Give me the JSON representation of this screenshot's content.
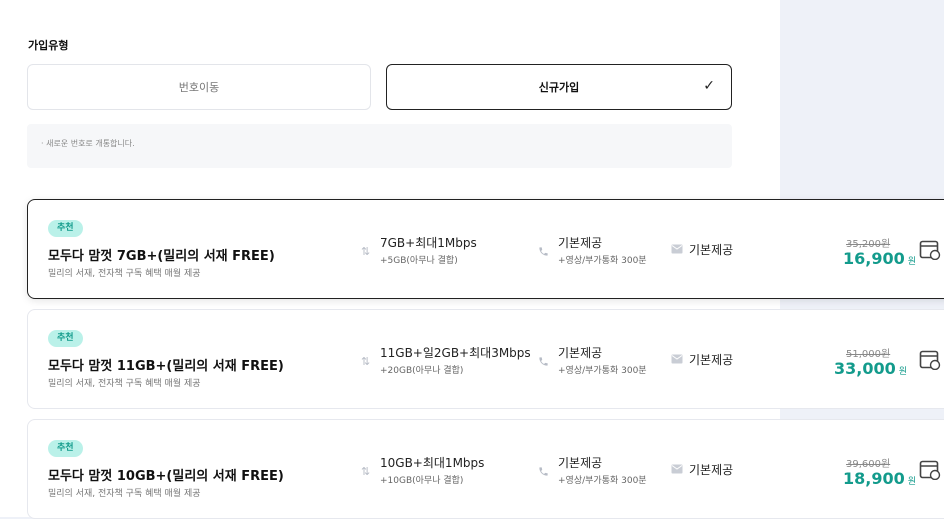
{
  "join_type": {
    "title": "가입유형",
    "options": [
      {
        "label": "번호이동",
        "selected": false
      },
      {
        "label": "신규가입",
        "selected": true
      }
    ],
    "check_glyph": "✓",
    "notice": "· 새로운 번호로 개통합니다."
  },
  "plans": [
    {
      "badge": "추천",
      "name": "모두다 맘껏 7GB+(밀리의 서재 FREE)",
      "desc": "밀리의 서재, 전자책 구독 혜택 매월 제공",
      "data_main": "7GB+최대1Mbps",
      "data_sub": "+5GB(아무나 결합)",
      "call_main": "기본제공",
      "call_sub": "+영상/부가통화 300분",
      "sms_main": "기본제공",
      "old_price": "35,200원",
      "new_price": "16,900",
      "currency": "원"
    },
    {
      "badge": "추천",
      "name": "모두다 맘껏 11GB+(밀리의 서재 FREE)",
      "desc": "밀리의 서재, 전자책 구독 혜택 매월 제공",
      "data_main": "11GB+일2GB+최대3Mbps",
      "data_sub": "+20GB(아무나 결합)",
      "call_main": "기본제공",
      "call_sub": "+영상/부가통화 300분",
      "sms_main": "기본제공",
      "old_price": "51,000원",
      "new_price": "33,000",
      "currency": "원"
    },
    {
      "badge": "추천",
      "name": "모두다 맘껏 10GB+(밀리의 서재 FREE)",
      "desc": "밀리의 서재, 전자책 구독 혜택 매월 제공",
      "data_main": "10GB+최대1Mbps",
      "data_sub": "+10GB(아무나 결합)",
      "call_main": "기본제공",
      "call_sub": "+영상/부가통화 300분",
      "sms_main": "기본제공",
      "old_price": "39,600원",
      "new_price": "18,900",
      "currency": "원"
    }
  ],
  "icons": {
    "data": "data-arrows-icon",
    "call": "phone-icon",
    "sms": "mail-icon",
    "cart": "cart-icon"
  },
  "colors": {
    "accent": "#139b8c",
    "badge_bg": "#baf1e9",
    "page_bg": "#eef1f8"
  }
}
